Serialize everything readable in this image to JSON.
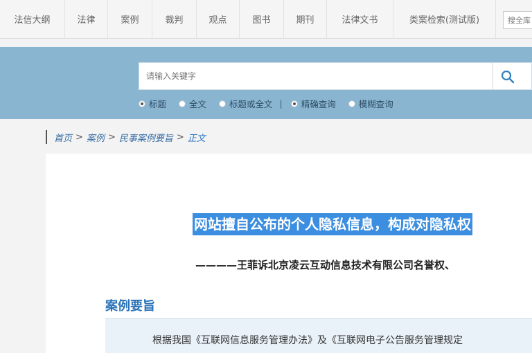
{
  "nav": {
    "items": [
      {
        "label": "法信大纲",
        "active": false
      },
      {
        "label": "法律",
        "active": false
      },
      {
        "label": "案例",
        "active": true
      },
      {
        "label": "裁判",
        "active": false
      },
      {
        "label": "观点",
        "active": false
      },
      {
        "label": "图书",
        "active": false
      },
      {
        "label": "期刊",
        "active": false
      },
      {
        "label": "法律文书",
        "active": false
      },
      {
        "label": "类案检索(测试版)",
        "active": false
      }
    ],
    "search_placeholder": "搜全库"
  },
  "search": {
    "placeholder": "请输入关键字",
    "scope_options": [
      {
        "label": "标题",
        "checked": true
      },
      {
        "label": "全文",
        "checked": false
      },
      {
        "label": "标题或全文",
        "checked": false
      }
    ],
    "mode_divider": "|",
    "mode_options": [
      {
        "label": "精确查询",
        "checked": true
      },
      {
        "label": "模糊查询",
        "checked": false
      }
    ]
  },
  "breadcrumb": {
    "items": [
      "首页",
      "案例",
      "民事案例要旨"
    ],
    "separator": ">",
    "current": "正文"
  },
  "article": {
    "title": "网站擅自公布的个人隐私信息，构成对隐私权",
    "subtitle": "————王菲诉北京凌云互动信息技术有限公司名誉权、",
    "section_heading": "案例要旨",
    "summary_text": "根据我国《互联网信息服务管理办法》及《互联网电子公告服务管理规定"
  },
  "colors": {
    "accent": "#3d8fc6",
    "band": "#8ab5d1",
    "title_highlight": "#3b8ee0",
    "section_heading": "#2b73b8"
  }
}
